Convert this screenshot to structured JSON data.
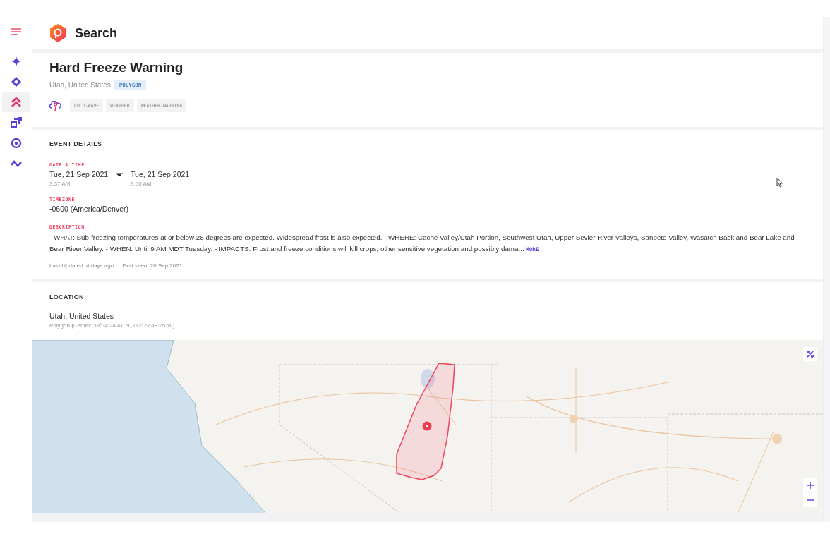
{
  "sidebar": {
    "items": [
      {
        "selected": false
      },
      {
        "selected": false
      },
      {
        "selected": true
      },
      {
        "selected": false
      },
      {
        "selected": false
      },
      {
        "selected": false
      }
    ]
  },
  "header": {
    "title": "Search"
  },
  "event": {
    "title": "Hard Freeze Warning",
    "place": "Utah, United States",
    "badge": "POLYGON",
    "tags": [
      "COLD-WAVE",
      "WEATHER",
      "WEATHER-WARNING"
    ]
  },
  "event_details": {
    "heading": "EVENT DETAILS",
    "date_label": "DATE & TIME",
    "start_date": "Tue, 21 Sep 2021",
    "start_time": "3:37 AM",
    "end_date": "Tue, 21 Sep 2021",
    "end_time": "9:00 AM",
    "timezone_label": "TIMEZONE",
    "timezone": "-0600 (America/Denver)",
    "description_label": "DESCRIPTION",
    "description": "- WHAT: Sub-freezing temperatures at or below 28 degrees are expected. Widespread frost is also expected. - WHERE: Cache Valley/Utah Portion, Southwest Utah, Upper Sevier River Valleys, Sanpete Valley, Wasatch Back and Bear Lake and Bear River Valley. - WHEN: Until 9 AM MDT Tuesday. - IMPACTS: Frost and freeze conditions will kill crops, other sensitive vegetation and possibly dama...",
    "more_link": "MORE",
    "last_updated": "Last Updated: 4 days ago",
    "first_seen": "First seen: 20 Sep 2021"
  },
  "location": {
    "heading": "LOCATION",
    "place": "Utah, United States",
    "center": "Polygon (Center: 39°34'24.41\"N, 112°27'48.25\"W)"
  }
}
